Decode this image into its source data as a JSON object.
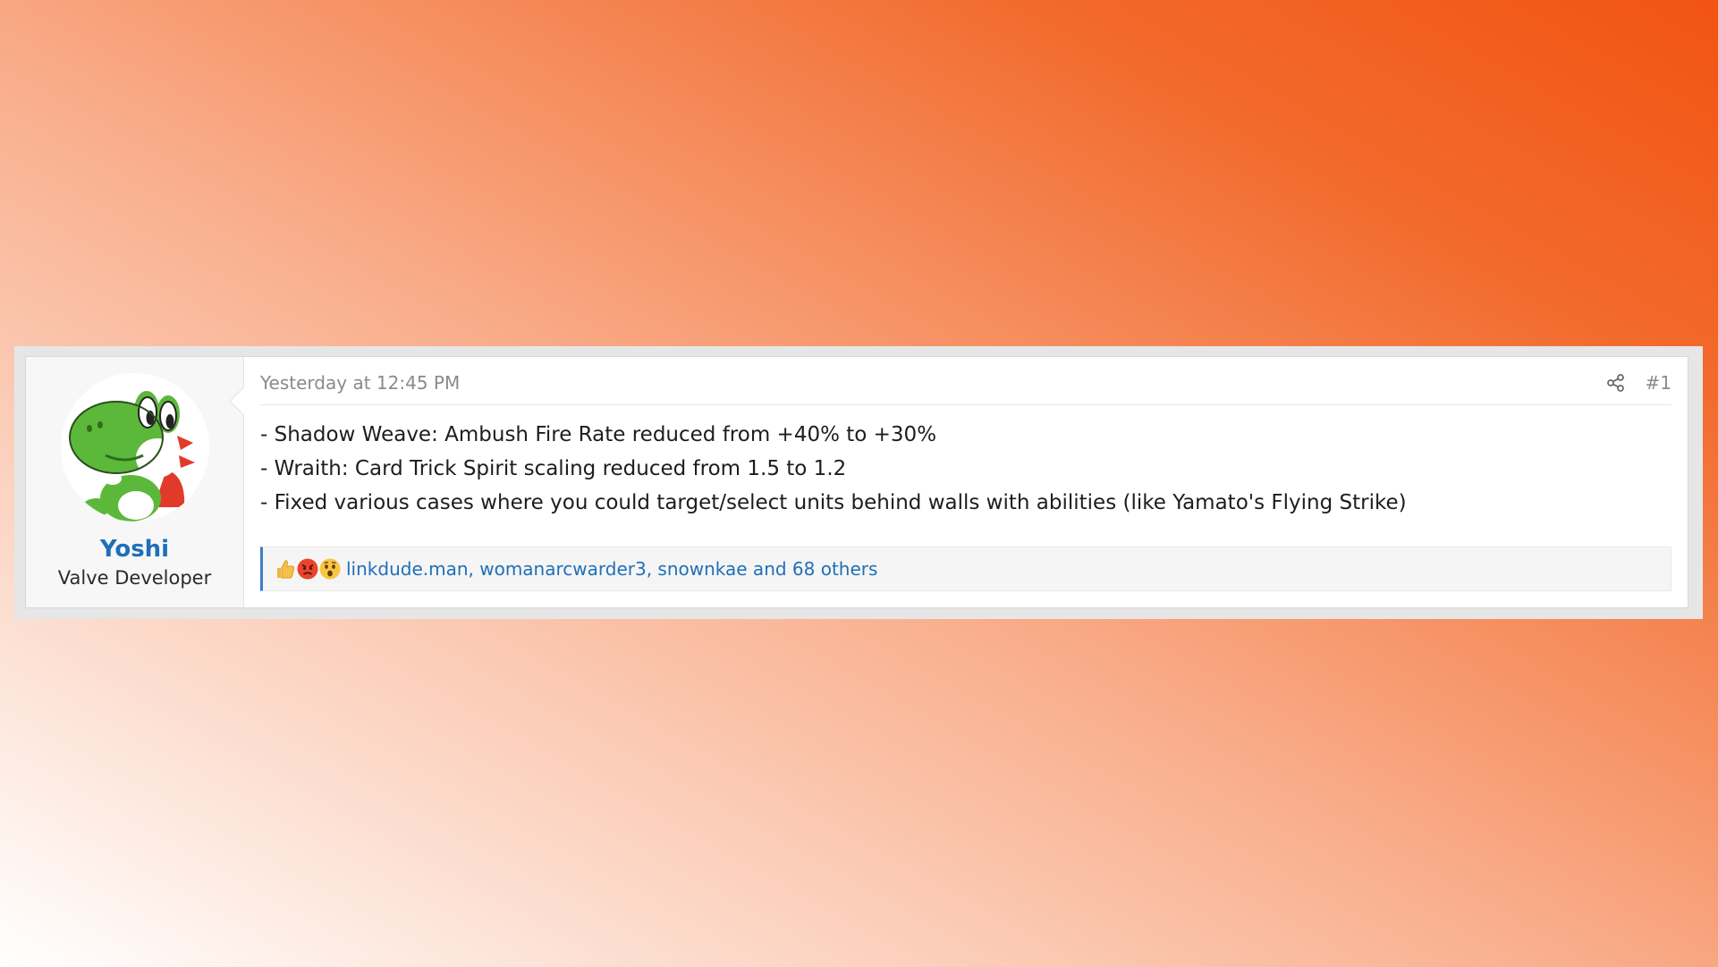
{
  "post": {
    "author": {
      "name": "Yoshi",
      "title": "Valve Developer",
      "avatar_icon": "yoshi-avatar"
    },
    "timestamp": "Yesterday at 12:45 PM",
    "share_icon": "share-icon",
    "post_number": "#1",
    "body_lines": [
      "- Shadow Weave: Ambush Fire Rate reduced from +40% to +30%",
      "- Wraith: Card Trick Spirit scaling reduced from 1.5 to 1.2",
      "- Fixed various cases where you could target/select units behind walls with abilities (like Yamato's Flying Strike)"
    ],
    "reactions": {
      "icons": [
        "thumbs-up-icon",
        "angry-face-icon",
        "surprised-face-icon"
      ],
      "text": "linkdude.man, womanarcwarder3, snownkae and 68 others"
    }
  },
  "colors": {
    "link": "#1f6fb8",
    "background_gradient": [
      "#ffffff",
      "#f25412"
    ],
    "reaction_bar_accent": "#3a7fc4"
  }
}
